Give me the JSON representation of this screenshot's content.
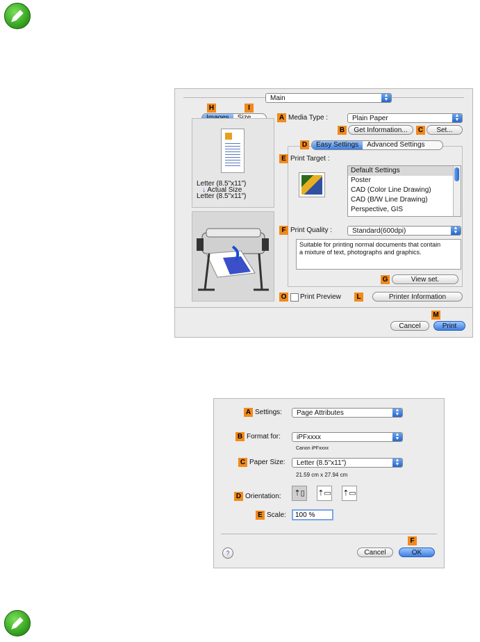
{
  "main_dialog": {
    "panel_select": "Main",
    "tabs_left": [
      {
        "tag": "H",
        "label": "Images"
      },
      {
        "tag": "I",
        "label": "Size"
      }
    ],
    "preview": {
      "size_line1": "Letter (8.5\"x11\")",
      "size_line2": "Actual Size",
      "size_line3": "Letter (8.5\"x11\")"
    },
    "media_type": {
      "tag": "A",
      "label": "Media Type :",
      "value": "Plain Paper"
    },
    "get_info": {
      "tag": "B",
      "label": "Get Information..."
    },
    "set": {
      "tag": "C",
      "label": "Set..."
    },
    "settings_tabs": {
      "tag": "D",
      "easy": "Easy Settings",
      "advanced": "Advanced Settings"
    },
    "print_target": {
      "tag": "E",
      "label": "Print Target :",
      "items": [
        "Default Settings",
        "Poster",
        "CAD (Color Line Drawing)",
        "CAD (B/W Line Drawing)",
        "Perspective, GIS"
      ]
    },
    "print_quality": {
      "tag": "F",
      "label": "Print Quality :",
      "value": "Standard(600dpi)",
      "description": "Suitable for printing normal documents that contain a mixture of text, photographs and graphics."
    },
    "view_set": {
      "tag": "G",
      "label": "View set."
    },
    "print_preview": {
      "tag": "O",
      "label": "Print Preview"
    },
    "printer_info": {
      "tag": "L",
      "label": "Printer Information"
    },
    "cancel": "Cancel",
    "print": {
      "tag": "M",
      "label": "Print"
    }
  },
  "page_setup": {
    "settings": {
      "tag": "A",
      "label": "Settings:",
      "value": "Page Attributes"
    },
    "format_for": {
      "tag": "B",
      "label": "Format for:",
      "value": "iPFxxxx",
      "sub": "Canon iPFxxxx"
    },
    "paper_size": {
      "tag": "C",
      "label": "Paper Size:",
      "value": "Letter (8.5\"x11\")",
      "sub": "21.59 cm x 27.94 cm"
    },
    "orientation": {
      "tag": "D",
      "label": "Orientation:"
    },
    "scale": {
      "tag": "E",
      "label": "Scale:",
      "value": "100 %"
    },
    "help": "?",
    "cancel": "Cancel",
    "ok": {
      "tag": "F",
      "label": "OK"
    }
  },
  "colors": {
    "tag": "#f08a1c",
    "accent": "#3f7fe0",
    "note_icon": "#2e9a1a"
  }
}
